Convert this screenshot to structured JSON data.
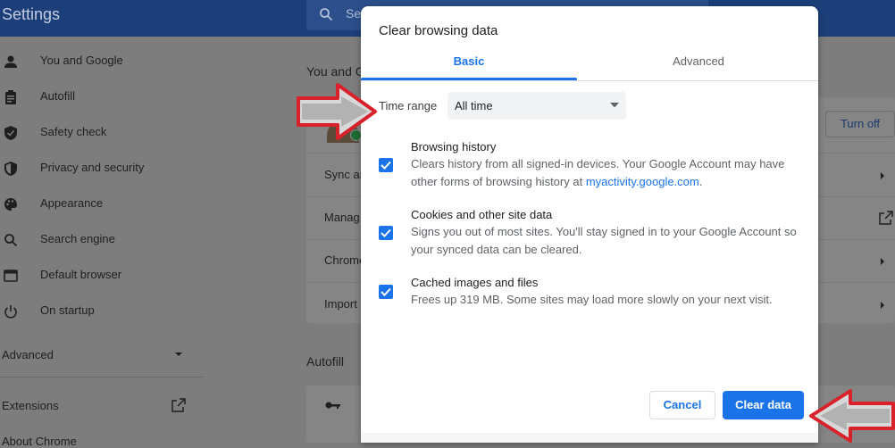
{
  "app": {
    "title": "Settings",
    "search_placeholder": "Se"
  },
  "sidebar": {
    "items": [
      {
        "label": "You and Google",
        "icon": "person-icon"
      },
      {
        "label": "Autofill",
        "icon": "clipboard-icon"
      },
      {
        "label": "Safety check",
        "icon": "shield-check-icon"
      },
      {
        "label": "Privacy and security",
        "icon": "shield-icon"
      },
      {
        "label": "Appearance",
        "icon": "palette-icon"
      },
      {
        "label": "Search engine",
        "icon": "search-icon"
      },
      {
        "label": "Default browser",
        "icon": "browser-icon"
      },
      {
        "label": "On startup",
        "icon": "power-icon"
      }
    ],
    "advanced": "Advanced",
    "extensions": "Extensions",
    "about": "About Chrome"
  },
  "background": {
    "section_you": "You and G",
    "turn_off": "Turn off",
    "rows": [
      "Sync an",
      "Manag",
      "Chrome",
      "Import"
    ],
    "section_autofill": "Autofill"
  },
  "dialog": {
    "title": "Clear browsing data",
    "tabs": [
      {
        "label": "Basic",
        "active": true
      },
      {
        "label": "Advanced",
        "active": false
      }
    ],
    "time_range_label": "Time range",
    "time_range_value": "All time",
    "options": [
      {
        "title": "Browsing history",
        "desc_before": "Clears history from all signed-in devices. Your Google Account may have other forms of browsing history at ",
        "link": "myactivity.google.com",
        "desc_after": ".",
        "checked": true
      },
      {
        "title": "Cookies and other site data",
        "desc": "Signs you out of most sites. You'll stay signed in to your Google Account so your synced data can be cleared.",
        "checked": true
      },
      {
        "title": "Cached images and files",
        "desc": "Frees up 319 MB. Some sites may load more slowly on your next visit.",
        "checked": true
      }
    ],
    "cancel_label": "Cancel",
    "clear_label": "Clear data"
  },
  "colors": {
    "accent": "#1a73e8",
    "topbar": "#1c3f7a",
    "annotation_arrow": "#d8212a"
  }
}
